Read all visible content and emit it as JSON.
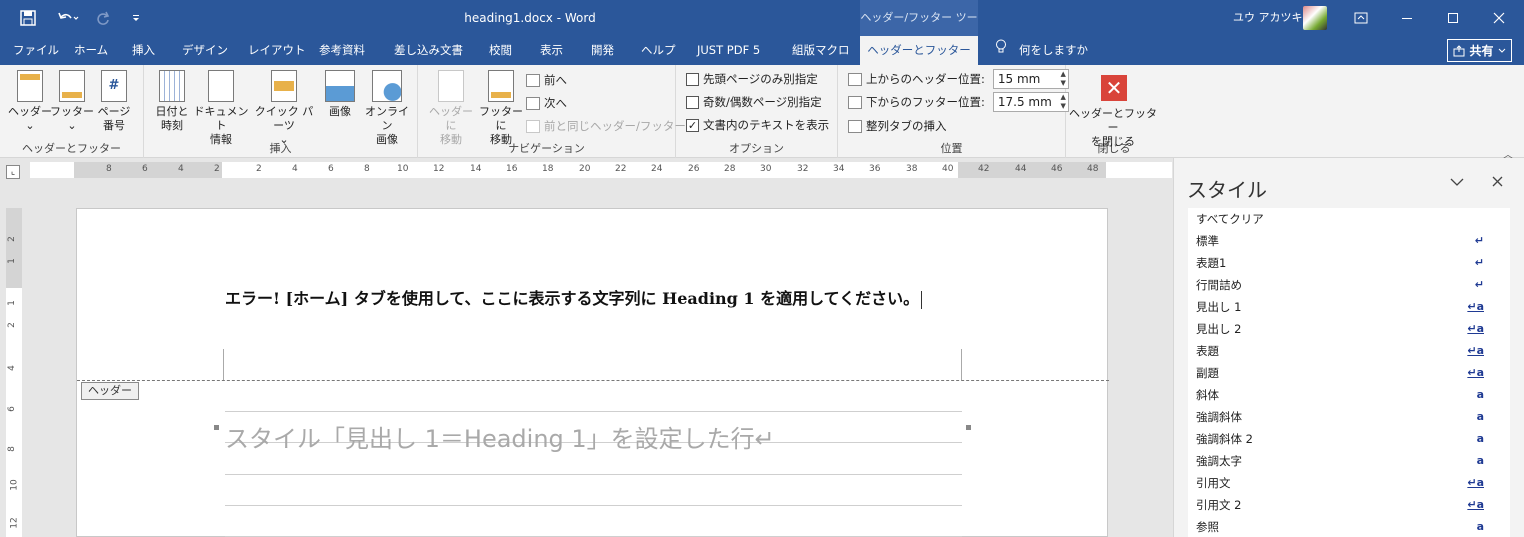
{
  "titlebar": {
    "document_title": "heading1.docx - Word",
    "contextual_tab": "ヘッダー/フッター ツール",
    "user_name": "ユウ アカツキ"
  },
  "tabs": [
    "ファイル",
    "ホーム",
    "挿入",
    "デザイン",
    "レイアウト",
    "参考資料",
    "差し込み文書",
    "校閲",
    "表示",
    "開発",
    "ヘルプ",
    "JUST PDF 5",
    "組版マクロ",
    "ヘッダーとフッター"
  ],
  "tell_me": "何をしますか",
  "share_label": "共有",
  "ribbon": {
    "hf_group": {
      "label": "ヘッダーとフッター",
      "buttons": [
        "ヘッダー",
        "フッター",
        "ページ\n番号"
      ]
    },
    "insert_group": {
      "label": "挿入",
      "buttons": [
        "日付と\n時刻",
        "ドキュメント\n情報",
        "クイック パーツ",
        "画像",
        "オンライン\n画像"
      ]
    },
    "nav_group": {
      "label": "ナビゲーション",
      "goto_header": "ヘッダーに\n移動",
      "goto_footer": "フッターに\n移動",
      "prev": "前へ",
      "next": "次へ",
      "link_prev": "前と同じヘッダー/フッター"
    },
    "options_group": {
      "label": "オプション",
      "first_page": "先頭ページのみ別指定",
      "odd_even": "奇数/偶数ページ別指定",
      "show_text": "文書内のテキストを表示",
      "first_page_checked": false,
      "odd_even_checked": false,
      "show_text_checked": true
    },
    "position_group": {
      "label": "位置",
      "header_pos_label": "上からのヘッダー位置:",
      "header_pos_value": "15 mm",
      "footer_pos_label": "下からのフッター位置:",
      "footer_pos_value": "17.5 mm",
      "align_tab": "整列タブの挿入"
    },
    "close_group": {
      "label": "閉じる",
      "close_button": "ヘッダーとフッター\nを閉じる"
    }
  },
  "ruler": {
    "left_numbers": [
      "8",
      "6",
      "4",
      "2"
    ],
    "right_numbers": [
      "2",
      "4",
      "6",
      "8",
      "10",
      "12",
      "14",
      "16",
      "18",
      "20",
      "22",
      "24",
      "26",
      "28",
      "30",
      "32",
      "34",
      "36",
      "38",
      "40",
      "42",
      "44",
      "46",
      "48"
    ],
    "vertical_numbers": [
      "2",
      "1",
      "1",
      "2",
      "4",
      "6",
      "8",
      "10",
      "12"
    ]
  },
  "document": {
    "header_text": "エラー! [ホーム] タブを使用して、ここに表示する文字列に Heading 1 を適用してください。",
    "header_label": "ヘッダー",
    "body_text": "スタイル「見出し 1＝Heading 1」を設定した行↵"
  },
  "styles_pane": {
    "title": "スタイル",
    "items": [
      {
        "name": "すべてクリア",
        "mark": ""
      },
      {
        "name": "標準",
        "mark": "↵"
      },
      {
        "name": "表題1",
        "mark": "↵"
      },
      {
        "name": "行間詰め",
        "mark": "↵"
      },
      {
        "name": "見出し 1",
        "mark": "↵a"
      },
      {
        "name": "見出し 2",
        "mark": "↵a"
      },
      {
        "name": "表題",
        "mark": "↵a"
      },
      {
        "name": "副題",
        "mark": "↵a"
      },
      {
        "name": "斜体",
        "mark": "a"
      },
      {
        "name": "強調斜体",
        "mark": "a"
      },
      {
        "name": "強調斜体 2",
        "mark": "a"
      },
      {
        "name": "強調太字",
        "mark": "a"
      },
      {
        "name": "引用文",
        "mark": "↵a"
      },
      {
        "name": "引用文 2",
        "mark": "↵a"
      },
      {
        "name": "参照",
        "mark": "a"
      }
    ]
  },
  "icons": {
    "save": "save-icon",
    "undo": "undo-icon",
    "redo": "redo-icon",
    "customize": "customize-qat-icon",
    "ribbon_display": "ribbon-display-options-icon",
    "minimize": "minimize-icon",
    "maximize": "maximize-icon",
    "close": "close-icon"
  },
  "colors": {
    "accent": "#2b579a",
    "close_red": "#d9443a",
    "style_mark": "#1f3a93"
  }
}
